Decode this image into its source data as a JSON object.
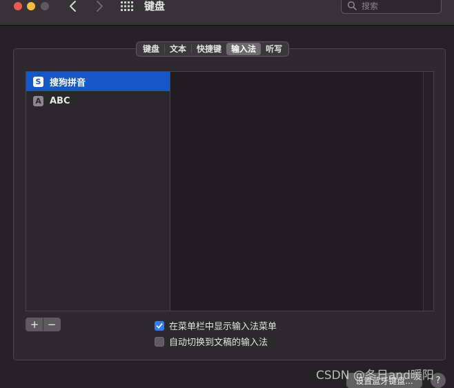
{
  "window": {
    "title": "键盘"
  },
  "search": {
    "placeholder": "搜索"
  },
  "tabs": [
    {
      "label": "键盘",
      "active": false
    },
    {
      "label": "文本",
      "active": false
    },
    {
      "label": "快捷键",
      "active": false
    },
    {
      "label": "输入法",
      "active": true
    },
    {
      "label": "听写",
      "active": false
    }
  ],
  "input_sources": [
    {
      "icon_text": "S",
      "icon": "sogou-pinyin-icon",
      "label": "搜狗拼音",
      "selected": true
    },
    {
      "icon_text": "A",
      "icon": "abc-icon",
      "label": "ABC",
      "selected": false
    }
  ],
  "list_controls": {
    "add": "+",
    "remove": "−"
  },
  "options": [
    {
      "label": "在菜单栏中显示输入法菜单",
      "checked": true
    },
    {
      "label": "自动切换到文稿的输入法",
      "checked": false
    }
  ],
  "footer": {
    "bluetooth_button": "设置蓝牙键盘...",
    "help": "?",
    "watermark": "CSDN @冬日and暖阳"
  },
  "colors": {
    "accent": "#1357c9",
    "checkbox_on": "#2f7cf6",
    "close": "#ee5a52",
    "minimize": "#f4bd3a"
  }
}
